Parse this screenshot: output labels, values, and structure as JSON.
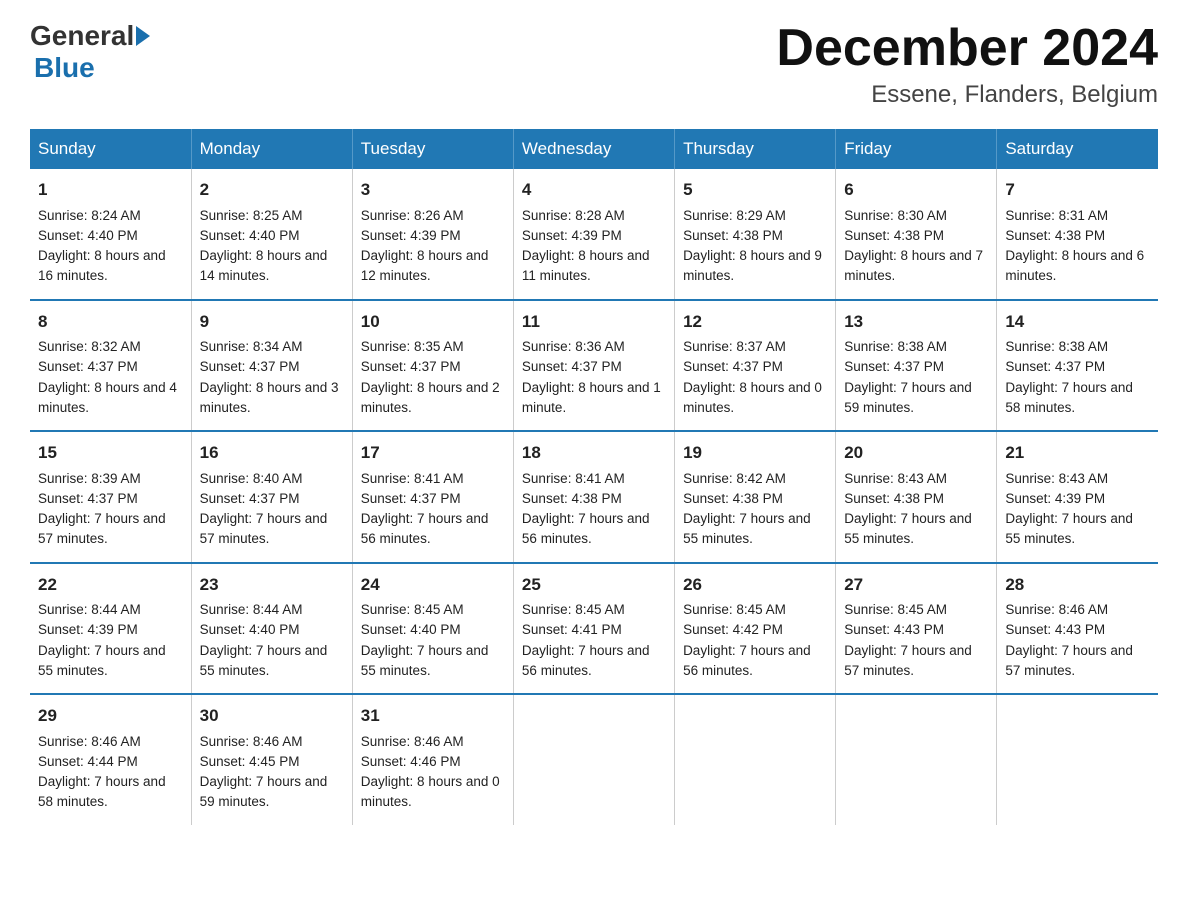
{
  "header": {
    "logo_general": "General",
    "logo_blue": "Blue",
    "title": "December 2024",
    "subtitle": "Essene, Flanders, Belgium"
  },
  "days_of_week": [
    "Sunday",
    "Monday",
    "Tuesday",
    "Wednesday",
    "Thursday",
    "Friday",
    "Saturday"
  ],
  "weeks": [
    [
      {
        "day": 1,
        "sunrise": "8:24 AM",
        "sunset": "4:40 PM",
        "daylight": "8 hours and 16 minutes."
      },
      {
        "day": 2,
        "sunrise": "8:25 AM",
        "sunset": "4:40 PM",
        "daylight": "8 hours and 14 minutes."
      },
      {
        "day": 3,
        "sunrise": "8:26 AM",
        "sunset": "4:39 PM",
        "daylight": "8 hours and 12 minutes."
      },
      {
        "day": 4,
        "sunrise": "8:28 AM",
        "sunset": "4:39 PM",
        "daylight": "8 hours and 11 minutes."
      },
      {
        "day": 5,
        "sunrise": "8:29 AM",
        "sunset": "4:38 PM",
        "daylight": "8 hours and 9 minutes."
      },
      {
        "day": 6,
        "sunrise": "8:30 AM",
        "sunset": "4:38 PM",
        "daylight": "8 hours and 7 minutes."
      },
      {
        "day": 7,
        "sunrise": "8:31 AM",
        "sunset": "4:38 PM",
        "daylight": "8 hours and 6 minutes."
      }
    ],
    [
      {
        "day": 8,
        "sunrise": "8:32 AM",
        "sunset": "4:37 PM",
        "daylight": "8 hours and 4 minutes."
      },
      {
        "day": 9,
        "sunrise": "8:34 AM",
        "sunset": "4:37 PM",
        "daylight": "8 hours and 3 minutes."
      },
      {
        "day": 10,
        "sunrise": "8:35 AM",
        "sunset": "4:37 PM",
        "daylight": "8 hours and 2 minutes."
      },
      {
        "day": 11,
        "sunrise": "8:36 AM",
        "sunset": "4:37 PM",
        "daylight": "8 hours and 1 minute."
      },
      {
        "day": 12,
        "sunrise": "8:37 AM",
        "sunset": "4:37 PM",
        "daylight": "8 hours and 0 minutes."
      },
      {
        "day": 13,
        "sunrise": "8:38 AM",
        "sunset": "4:37 PM",
        "daylight": "7 hours and 59 minutes."
      },
      {
        "day": 14,
        "sunrise": "8:38 AM",
        "sunset": "4:37 PM",
        "daylight": "7 hours and 58 minutes."
      }
    ],
    [
      {
        "day": 15,
        "sunrise": "8:39 AM",
        "sunset": "4:37 PM",
        "daylight": "7 hours and 57 minutes."
      },
      {
        "day": 16,
        "sunrise": "8:40 AM",
        "sunset": "4:37 PM",
        "daylight": "7 hours and 57 minutes."
      },
      {
        "day": 17,
        "sunrise": "8:41 AM",
        "sunset": "4:37 PM",
        "daylight": "7 hours and 56 minutes."
      },
      {
        "day": 18,
        "sunrise": "8:41 AM",
        "sunset": "4:38 PM",
        "daylight": "7 hours and 56 minutes."
      },
      {
        "day": 19,
        "sunrise": "8:42 AM",
        "sunset": "4:38 PM",
        "daylight": "7 hours and 55 minutes."
      },
      {
        "day": 20,
        "sunrise": "8:43 AM",
        "sunset": "4:38 PM",
        "daylight": "7 hours and 55 minutes."
      },
      {
        "day": 21,
        "sunrise": "8:43 AM",
        "sunset": "4:39 PM",
        "daylight": "7 hours and 55 minutes."
      }
    ],
    [
      {
        "day": 22,
        "sunrise": "8:44 AM",
        "sunset": "4:39 PM",
        "daylight": "7 hours and 55 minutes."
      },
      {
        "day": 23,
        "sunrise": "8:44 AM",
        "sunset": "4:40 PM",
        "daylight": "7 hours and 55 minutes."
      },
      {
        "day": 24,
        "sunrise": "8:45 AM",
        "sunset": "4:40 PM",
        "daylight": "7 hours and 55 minutes."
      },
      {
        "day": 25,
        "sunrise": "8:45 AM",
        "sunset": "4:41 PM",
        "daylight": "7 hours and 56 minutes."
      },
      {
        "day": 26,
        "sunrise": "8:45 AM",
        "sunset": "4:42 PM",
        "daylight": "7 hours and 56 minutes."
      },
      {
        "day": 27,
        "sunrise": "8:45 AM",
        "sunset": "4:43 PM",
        "daylight": "7 hours and 57 minutes."
      },
      {
        "day": 28,
        "sunrise": "8:46 AM",
        "sunset": "4:43 PM",
        "daylight": "7 hours and 57 minutes."
      }
    ],
    [
      {
        "day": 29,
        "sunrise": "8:46 AM",
        "sunset": "4:44 PM",
        "daylight": "7 hours and 58 minutes."
      },
      {
        "day": 30,
        "sunrise": "8:46 AM",
        "sunset": "4:45 PM",
        "daylight": "7 hours and 59 minutes."
      },
      {
        "day": 31,
        "sunrise": "8:46 AM",
        "sunset": "4:46 PM",
        "daylight": "8 hours and 0 minutes."
      },
      null,
      null,
      null,
      null
    ]
  ]
}
